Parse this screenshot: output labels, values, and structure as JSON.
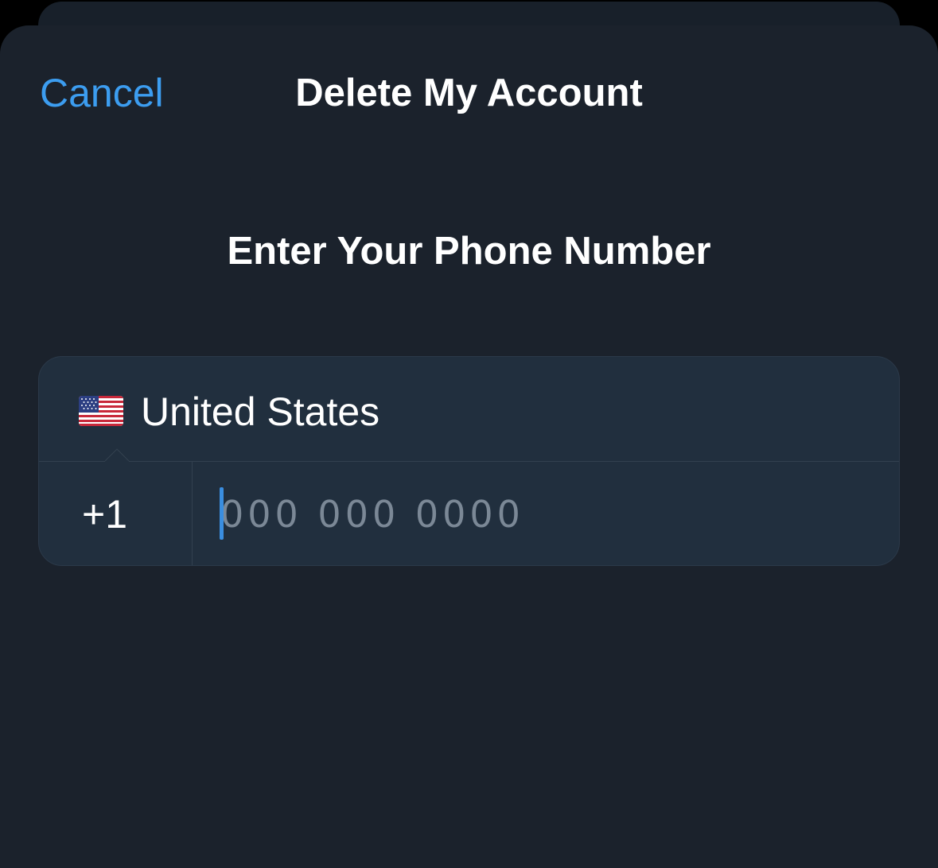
{
  "nav": {
    "cancel_label": "Cancel",
    "title": "Delete My Account"
  },
  "heading": "Enter Your Phone Number",
  "country": {
    "flag_icon": "us-flag-icon",
    "name": "United States",
    "dial_code": "+1"
  },
  "phone": {
    "value": "",
    "placeholder": "000 000 0000"
  },
  "colors": {
    "accent": "#3c9df0",
    "background": "#1b222c",
    "card": "#212f3e",
    "placeholder": "#7b8896"
  }
}
